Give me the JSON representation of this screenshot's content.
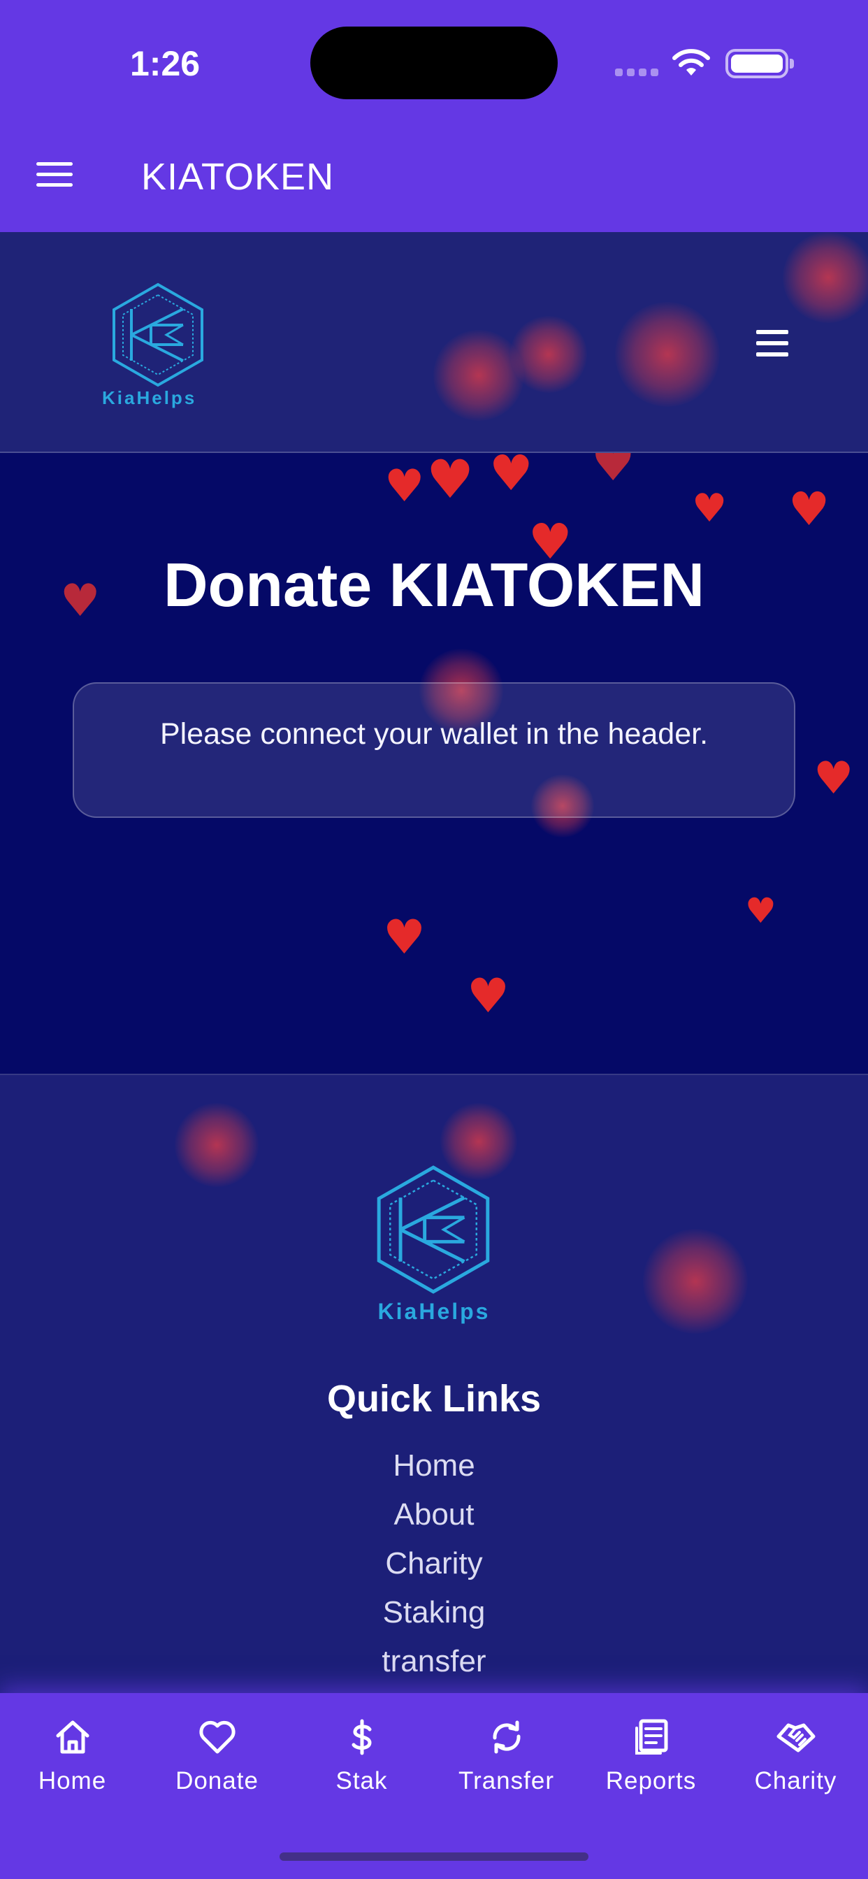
{
  "status_bar": {
    "time": "1:26"
  },
  "app_bar": {
    "title": "KIATOKEN"
  },
  "site_header": {
    "logo_text": "KiaHelps"
  },
  "donate": {
    "title": "Donate KIATOKEN",
    "notice": "Please connect your wallet in the header."
  },
  "footer": {
    "logo_text": "KiaHelps",
    "quick_links_title": "Quick Links",
    "links": [
      "Home",
      "About",
      "Charity",
      "Staking",
      "transfer"
    ]
  },
  "tab_bar": {
    "tabs": [
      {
        "label": "Home",
        "icon": "home-icon"
      },
      {
        "label": "Donate",
        "icon": "heart-icon"
      },
      {
        "label": "Stak",
        "icon": "dollar-icon"
      },
      {
        "label": "Transfer",
        "icon": "refresh-icon"
      },
      {
        "label": "Reports",
        "icon": "document-icon"
      },
      {
        "label": "Charity",
        "icon": "handshake-icon"
      }
    ]
  },
  "colors": {
    "primary": "#6438e4",
    "section_dark": "#050967",
    "section_mid": "#1c1f78",
    "logo": "#2aa9df",
    "heart": "#e52a2a"
  }
}
